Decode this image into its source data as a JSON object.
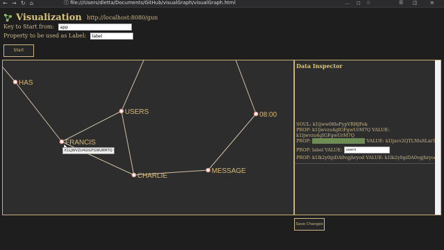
{
  "browser": {
    "url": "file:///Users/dletta/Documents/GitHub/visualGraph/visualGraph.html",
    "dots": "…",
    "star": "☆"
  },
  "header": {
    "title": "Visualization",
    "subtitle": "http://localhost:8080/gun"
  },
  "form": {
    "key_label": "Key to Start from:",
    "key_value": "app",
    "property_label": "Property to be used as Label:",
    "property_value": "label",
    "start_button": "Start"
  },
  "graph": {
    "nodes": [
      {
        "label": "HAS"
      },
      {
        "label": "USERS"
      },
      {
        "label": "FRANCIS"
      },
      {
        "label": "CHARLIE"
      },
      {
        "label": "MESSAGE"
      },
      {
        "label": "08:00"
      }
    ],
    "tooltip": "K1LJWVZU4GIGFGWURM7Q"
  },
  "inspector": {
    "title": "Data Inspector",
    "soul": "SOUL: k1ljww08lePypVRHjFek",
    "prop1_line1": "PROP: k1ljwvzu4gIGFgwUrM7Q VALUE:",
    "prop1_line2": "k1ljwvzu4gIGFgwUrM7Q",
    "prop2_prefix": "PROP:",
    "prop2_key": "k1ljxcv2QTLNlsSLxr56",
    "prop2_mid": "VALUE:",
    "prop2_value": "k1ljxcv2QTLNlsSLxr56",
    "label_prefix": "PROP: label VALUE:",
    "label_value": "users",
    "prop3": "PROP: k1lk2y0giDA0vgjhryod VALUE: k1lk2y0giDA0vgjhryod"
  },
  "save_button": "Save Changes",
  "colors": {
    "node_stroke": "#f0a090",
    "edge": "#cfc0a8",
    "highlight": "#6e8d55"
  }
}
